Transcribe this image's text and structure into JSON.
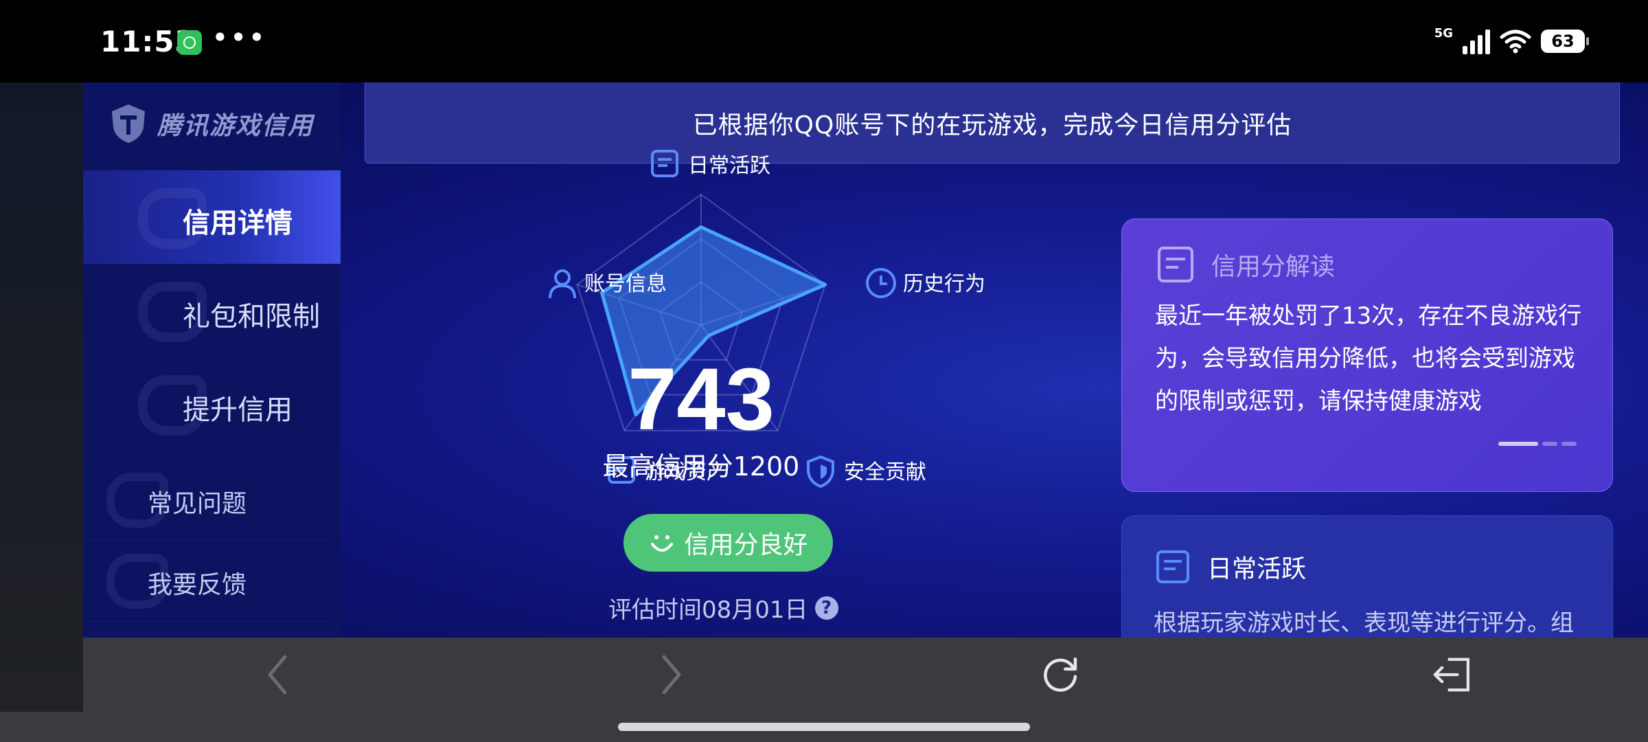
{
  "status_bar": {
    "time": "11:53",
    "dots": "•••",
    "network": "5G",
    "battery": "63"
  },
  "brand": {
    "name": "腾讯游戏信用"
  },
  "nav": {
    "items": [
      {
        "label": "信用详情",
        "active": true
      },
      {
        "label": "礼包和限制",
        "active": false
      },
      {
        "label": "提升信用",
        "active": false
      }
    ],
    "links": [
      {
        "label": "常见问题"
      },
      {
        "label": "我要反馈"
      }
    ]
  },
  "banner": {
    "text": "已根据你QQ账号下的在玩游戏，完成今日信用分评估"
  },
  "credit": {
    "score": "743",
    "max_label": "最高信用分1200",
    "status": "信用分良好",
    "eval_time": "评估时间08月01日",
    "help": "?"
  },
  "radar": {
    "axes": [
      "日常活跃",
      "历史行为",
      "安全贡献",
      "游戏资产",
      "账号信息"
    ],
    "values": [
      0.75,
      1.0,
      0.1,
      0.85,
      0.8
    ]
  },
  "interpretation_card": {
    "title": "信用分解读",
    "body": "最近一年被处罚了13次，存在不良游戏行为，会导致信用分降低，也将会受到游戏的限制或惩罚，请保持健康游戏"
  },
  "daily_card": {
    "title": "日常活跃",
    "body": "根据玩家游戏时长、表现等进行评分。组"
  },
  "colors": {
    "accent_green": "#4fc57a",
    "card_purple": "#5b3fd6",
    "bg_blue": "#12198a"
  },
  "toolbar": {
    "icons": [
      "back-icon",
      "forward-icon",
      "refresh-icon",
      "exit-icon"
    ]
  }
}
